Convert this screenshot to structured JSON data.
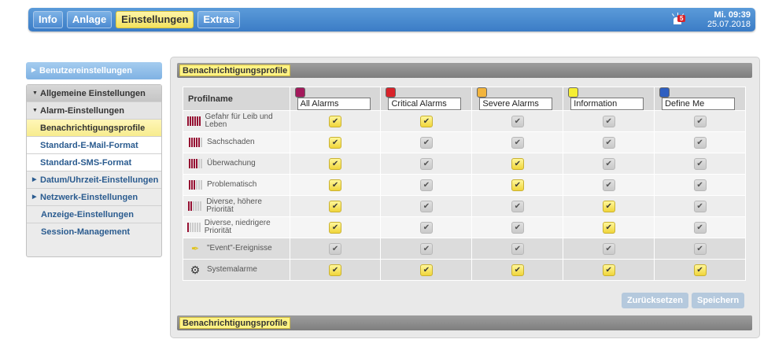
{
  "topnav": {
    "tabs": [
      {
        "label": "Info",
        "active": false
      },
      {
        "label": "Anlage",
        "active": false
      },
      {
        "label": "Einstellungen",
        "active": true
      },
      {
        "label": "Extras",
        "active": false
      }
    ]
  },
  "status": {
    "alarm_count": "5",
    "time": "Mi. 09:39",
    "date": "25.07.2018"
  },
  "sidebar": {
    "top_item": "Benutzereinstellungen",
    "items": [
      {
        "label": "Allgemeine Einstellungen"
      },
      {
        "label": "Alarm-Einstellungen"
      },
      {
        "label": "Benachrichtigungsprofile"
      },
      {
        "label": "Standard-E-Mail-Format"
      },
      {
        "label": "Standard-SMS-Format"
      },
      {
        "label": "Datum/Uhrzeit-Einstellungen"
      },
      {
        "label": "Netzwerk-Einstellungen"
      },
      {
        "label": "Anzeige-Einstellungen"
      },
      {
        "label": "Session-Management"
      }
    ]
  },
  "panel": {
    "title": "Benachrichtigungsprofile",
    "footer_title": "Benachrichtigungsprofile",
    "column_header": "Profilname",
    "profiles": [
      {
        "name": "All Alarms",
        "color": "#a3195b"
      },
      {
        "name": "Critical Alarms",
        "color": "#d8232a"
      },
      {
        "name": "Severe Alarms",
        "color": "#f2b43c"
      },
      {
        "name": "Information",
        "color": "#f6ef34"
      },
      {
        "name": "Define Me",
        "color": "#2f5fc1"
      }
    ],
    "rows": [
      {
        "label": "Gefahr für Leib und Leben",
        "icon": "severity-6-icon",
        "level": 6,
        "checked": [
          true,
          true,
          false,
          false,
          false
        ]
      },
      {
        "label": "Sachschaden",
        "icon": "severity-5-icon",
        "level": 5,
        "checked": [
          true,
          false,
          false,
          false,
          false
        ]
      },
      {
        "label": "Überwachung",
        "icon": "severity-4-icon",
        "level": 4,
        "checked": [
          true,
          false,
          true,
          false,
          false
        ]
      },
      {
        "label": "Problematisch",
        "icon": "severity-3-icon",
        "level": 3,
        "checked": [
          true,
          false,
          true,
          false,
          false
        ]
      },
      {
        "label": "Diverse, höhere Priorität",
        "icon": "severity-2-icon",
        "level": 2,
        "checked": [
          true,
          false,
          false,
          true,
          false
        ]
      },
      {
        "label": "Diverse, niedrigere Priorität",
        "icon": "severity-1-icon",
        "level": 1,
        "checked": [
          true,
          false,
          false,
          true,
          false
        ]
      },
      {
        "label": "\"Event\"-Ereignisse",
        "icon": "event-icon",
        "checked": [
          false,
          false,
          false,
          false,
          false
        ]
      },
      {
        "label": "Systemalarme",
        "icon": "gear-icon",
        "checked": [
          true,
          true,
          true,
          true,
          true
        ]
      }
    ],
    "reset_label": "Zurücksetzen",
    "save_label": "Speichern"
  }
}
